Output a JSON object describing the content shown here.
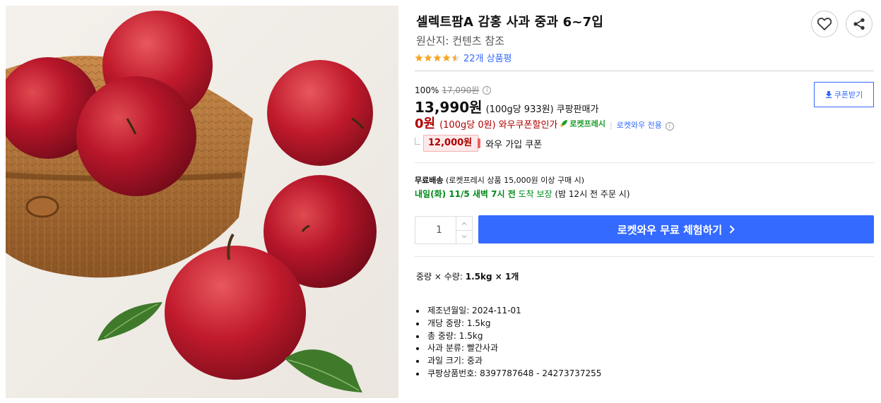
{
  "product": {
    "title": "셀렉트팜A 감홍 사과 중과 6~7입",
    "origin": "원산지: 컨텐츠 참조",
    "rating": 4.5,
    "review_count": "22개 상품평"
  },
  "price": {
    "discount_rate": "100%",
    "original_price": "17,090원",
    "sale_price": "13,990원",
    "unit_price": "(100g당 933원)",
    "sale_label": "쿠팡판매가",
    "wow_price": "0원",
    "wow_unit_price": "(100g당 0원)",
    "wow_label": "와우쿠폰할인가",
    "rocket_fresh": "로켓프레시",
    "wow_only": "로켓와우 전용",
    "coupon_amount": "12,000원",
    "coupon_text": "와우 가입 쿠폰",
    "coupon_download": "쿠폰받기"
  },
  "shipping": {
    "free_label": "무료배송",
    "free_condition": "(로켓프레시 상품 15,000원 이상 구매 시)",
    "arrival": "내일(화) 11/5 새벽 7시 전",
    "arrival_guarantee": "도착 보장",
    "order_deadline": "(밤 12시 전 주문 시)"
  },
  "purchase": {
    "quantity": "1",
    "cta_label": "로켓와우 무료 체험하기"
  },
  "option": {
    "label": "중량 × 수량:",
    "value": "1.5kg × 1개"
  },
  "specs": [
    "제조년월일: 2024-11-01",
    "개당 중량: 1.5kg",
    "총 중량: 1.5kg",
    "사과 분류: 빨간사과",
    "과일 크기: 중과",
    "쿠팡상품번호: 8397787648 - 24273737255"
  ],
  "colors": {
    "accent_blue": "#346aff",
    "wow_red": "#ae0000",
    "delivery_green": "#00891a",
    "star_orange": "#f5a623"
  },
  "icons": {
    "wishlist": "heart-icon",
    "share": "share-icon",
    "info": "info-icon",
    "download": "download-icon",
    "rocket": "rocket-icon"
  }
}
